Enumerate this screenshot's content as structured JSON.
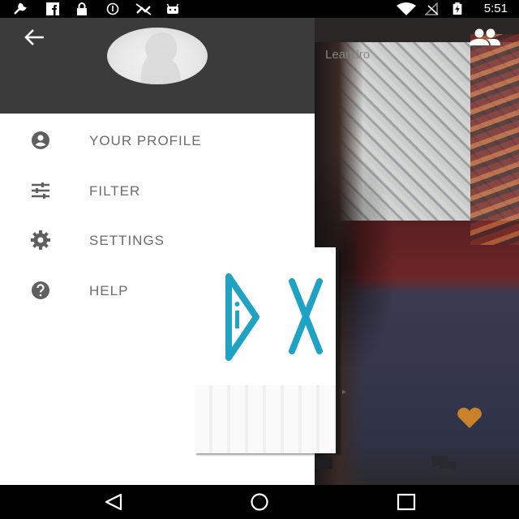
{
  "status_bar": {
    "time": "5:51",
    "left_icons": [
      "wrench-icon",
      "facebook-icon",
      "lock-icon",
      "sync-icon",
      "no-satellite-icon",
      "android-icon"
    ],
    "right_icons": [
      "wifi-icon",
      "no-signal-icon",
      "battery-charging-icon"
    ]
  },
  "drawer": {
    "menu": [
      {
        "label": "YOUR PROFILE",
        "icon": "account-circle-icon"
      },
      {
        "label": "FILTER",
        "icon": "sliders-icon"
      },
      {
        "label": "SETTINGS",
        "icon": "gear-icon"
      },
      {
        "label": "HELP",
        "icon": "help-circle-icon"
      }
    ]
  },
  "background": {
    "user_name": "Leandro"
  },
  "ad": {
    "letter": "X"
  },
  "nav_bar": {
    "buttons": [
      "back-triangle-icon",
      "home-circle-icon",
      "recents-square-icon"
    ]
  },
  "colors": {
    "drawer_header": "#3b3b3b",
    "menu_text": "#6b6b6b",
    "ad_accent": "#1ea3c4",
    "heart": "#c9822a"
  }
}
